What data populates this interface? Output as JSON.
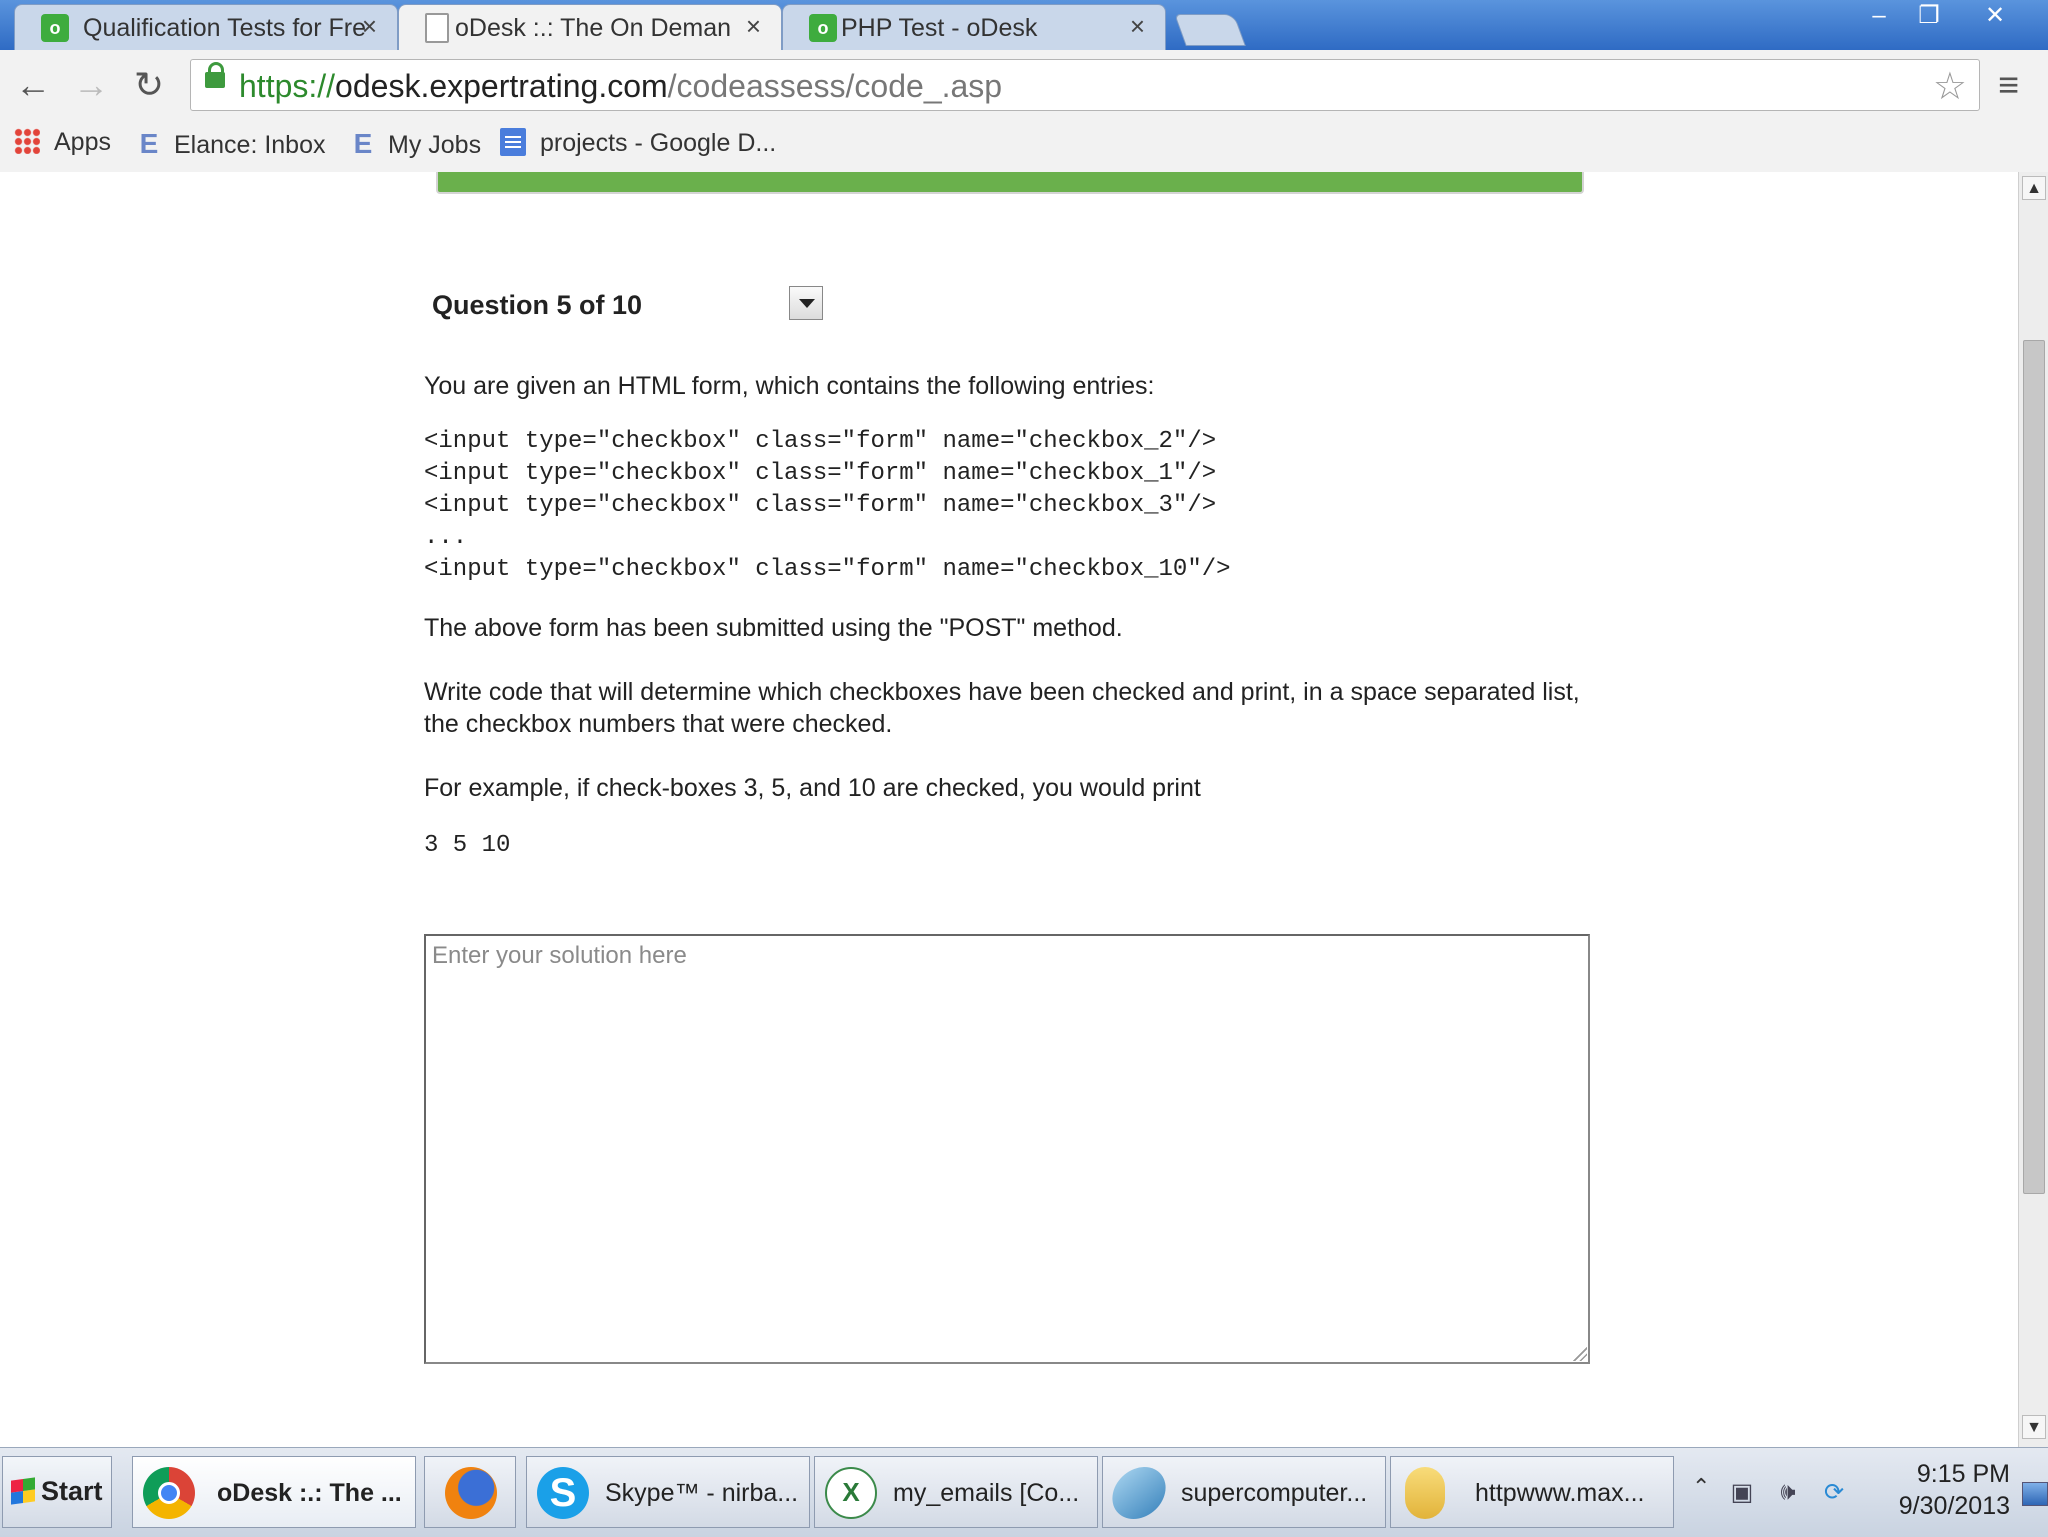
{
  "browser": {
    "tabs": [
      {
        "title": "Qualification Tests for Fre",
        "close": "×"
      },
      {
        "title": "oDesk :.: The On Deman",
        "close": "×"
      },
      {
        "title": "PHP Test - oDesk",
        "close": "×"
      }
    ],
    "url": {
      "scheme": "https://",
      "host": "odesk.expertrating.com",
      "path": "/codeassess/code_.asp"
    },
    "bookmarks": [
      {
        "label": "Apps"
      },
      {
        "label": "Elance: Inbox",
        "icon": "E"
      },
      {
        "label": "My Jobs",
        "icon": "E"
      },
      {
        "label": "projects - Google D..."
      }
    ]
  },
  "page": {
    "question_title": "Question 5 of 10",
    "intro": "You are given an HTML form, which contains the following entries:",
    "code_lines": [
      "<input type=\"checkbox\" class=\"form\" name=\"checkbox_2\"/>",
      "<input type=\"checkbox\" class=\"form\" name=\"checkbox_1\"/>",
      "<input type=\"checkbox\" class=\"form\" name=\"checkbox_3\"/>",
      "...",
      "<input type=\"checkbox\" class=\"form\" name=\"checkbox_10\"/>"
    ],
    "submitted_text": "The above form has been submitted using the \"POST\" method.",
    "task_text": "Write code that will determine which checkboxes have been checked and print, in a space separated list, the checkbox numbers that were checked.",
    "example_text": "For example, if check-boxes 3, 5, and 10 are checked, you would print",
    "example_output": "3 5 10",
    "answer_placeholder": "Enter your solution here"
  },
  "taskbar": {
    "start_label": "Start",
    "tasks": [
      {
        "label": "oDesk :.: The ...",
        "icon": "chrome-icon"
      },
      {
        "label": "",
        "icon": "firefox-icon"
      },
      {
        "label": "Skype™ - nirba...",
        "icon": "skype-icon"
      },
      {
        "label": "my_emails  [Co...",
        "icon": "excel-icon"
      },
      {
        "label": "supercomputer...",
        "icon": "app-icon"
      },
      {
        "label": "httpwww.max...",
        "icon": "folder-icon"
      }
    ],
    "clock": {
      "time": "9:15 PM",
      "date": "9/30/2013"
    }
  },
  "colors": {
    "titlebar": "#2f6bc4",
    "progress_bar": "#6ab04c",
    "url_scheme": "#2d8a2d"
  }
}
